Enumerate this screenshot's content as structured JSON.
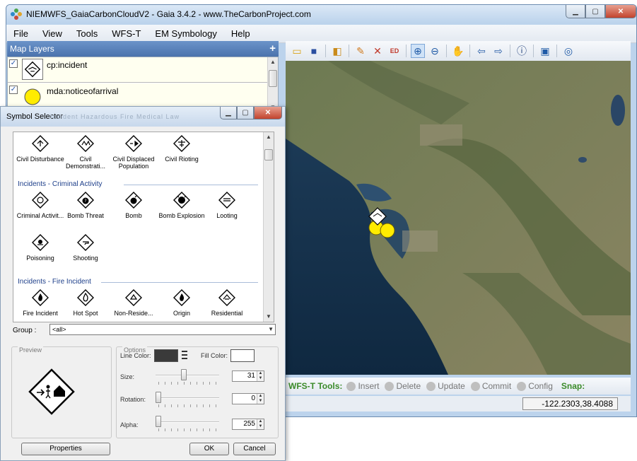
{
  "window": {
    "title": "NIEMWFS_GaiaCarbonCloudV2 - Gaia 3.4.2 - www.TheCarbonProject.com",
    "controls": {
      "minimize": "▁",
      "maximize": "▢",
      "close": "✕"
    }
  },
  "menu": [
    {
      "label": "File"
    },
    {
      "label": "View"
    },
    {
      "label": "Tools"
    },
    {
      "label": "WFS-T"
    },
    {
      "label": "EM Symbology"
    },
    {
      "label": "Help"
    }
  ],
  "layers": {
    "title": "Map Layers",
    "add_icon": "+",
    "items": [
      {
        "name": "cp:incident",
        "checked": "✓"
      },
      {
        "name": "mda:noticeofarrival",
        "checked": "✓"
      }
    ]
  },
  "toolbar_icons": [
    "open-folder-icon",
    "save-icon",
    "properties-icon",
    "edit-icon",
    "chart-icon",
    "edit-label-icon",
    "zoom-in-icon",
    "zoom-out-icon",
    "pan-hand-icon",
    "back-arrow-icon",
    "forward-arrow-icon",
    "info-icon",
    "full-extent-icon",
    "refresh-icon"
  ],
  "wfs": {
    "label": "WFS-T Tools:",
    "insert": "Insert",
    "delete": "Delete",
    "update": "Update",
    "commit": "Commit",
    "config": "Config",
    "snap": "Snap:"
  },
  "status": {
    "coords": "-122.2303,38.4088"
  },
  "dialog": {
    "title": "Symbol Selector",
    "ghost_text": "Incident  Hazardous  Fire  Medical  Law",
    "row1": [
      {
        "label": "Civil Disturbance"
      },
      {
        "label": "Civil Demonstrati..."
      },
      {
        "label": "Civil Displaced Population"
      },
      {
        "label": "Civil Rioting"
      }
    ],
    "cat_criminal": "Incidents - Criminal Activity",
    "row2": [
      {
        "label": "Criminal Activit..."
      },
      {
        "label": "Bomb Threat"
      },
      {
        "label": "Bomb"
      },
      {
        "label": "Bomb Explosion"
      },
      {
        "label": "Looting"
      }
    ],
    "row3": [
      {
        "label": "Poisoning"
      },
      {
        "label": "Shooting"
      }
    ],
    "cat_fire": "Incidents - Fire Incident",
    "row4": [
      {
        "label": "Fire Incident"
      },
      {
        "label": "Hot Spot"
      },
      {
        "label": "Non-Reside..."
      },
      {
        "label": "Origin"
      },
      {
        "label": "Residential"
      }
    ],
    "group_label": "Group :",
    "group_value": "<all>",
    "preview_label": "Preview",
    "options_label": "Options",
    "line_color_label": "Line Color:",
    "fill_color_label": "Fill Color:",
    "size_label": "Size:",
    "size_value": "31",
    "rotation_label": "Rotation:",
    "rotation_value": "0",
    "alpha_label": "Alpha:",
    "alpha_value": "255",
    "properties_btn": "Properties",
    "ok_btn": "OK",
    "cancel_btn": "Cancel"
  }
}
